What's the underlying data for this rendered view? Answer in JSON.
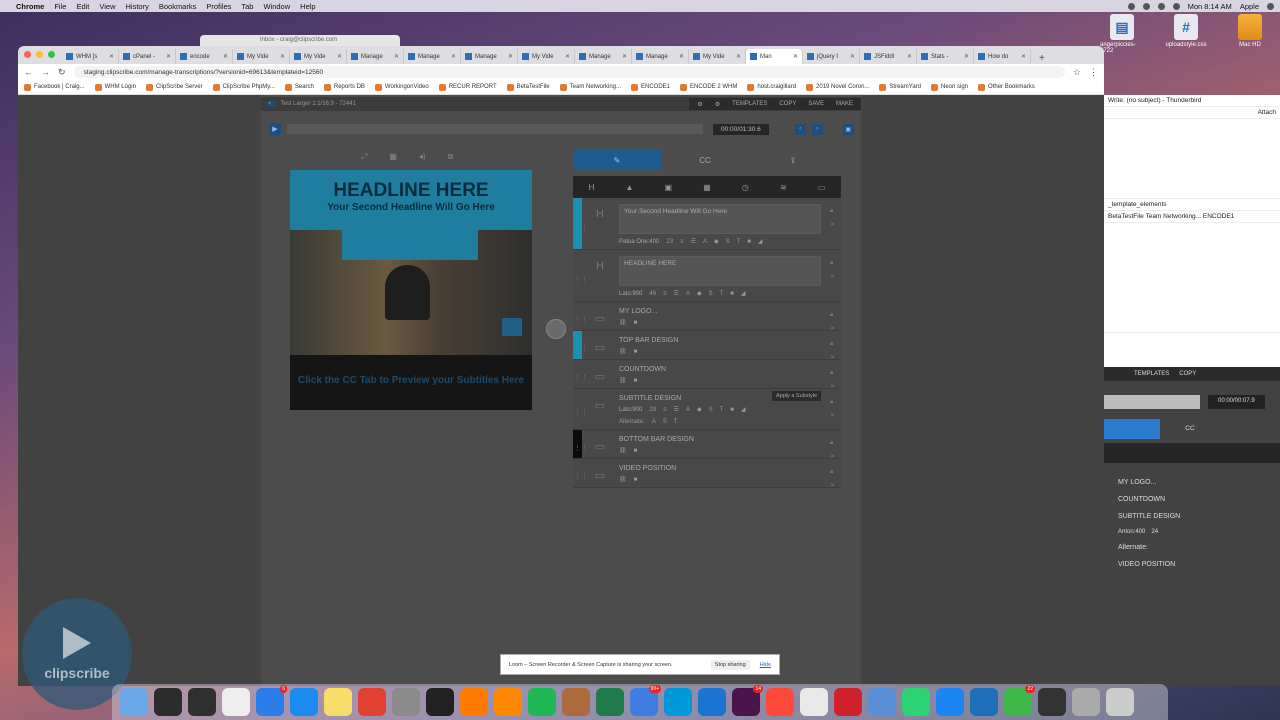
{
  "menubar": {
    "app": "Chrome",
    "items": [
      "File",
      "Edit",
      "View",
      "History",
      "Bookmarks",
      "Profiles",
      "Tab",
      "Window",
      "Help"
    ],
    "clock": "Mon 8:14 AM",
    "user": "Apple"
  },
  "desktop": {
    "icons": [
      {
        "label": "angerpiccies-4722",
        "icon": "file-icon"
      },
      {
        "label": "uploadstyle.css",
        "icon": "css-file-icon"
      },
      {
        "label": "Mac HD",
        "icon": "hard-drive-icon"
      }
    ],
    "bg_window_text": "Inbox - craig@clipscribe.com"
  },
  "browser": {
    "tabs": [
      "WHM [s",
      "cPanel -",
      "encode",
      "My Vide",
      "My Vide",
      "Manage",
      "Manage",
      "Manage",
      "My Vide",
      "Manage",
      "Manage",
      "My Vide",
      "Man",
      "jQuery t",
      "JSFiddl",
      "Stats -",
      "How do"
    ],
    "active_tab": 12,
    "url": "staging.clipscribe.com/manage-transcriptions/?versionid=69613&templateid=12560",
    "bookmarks": [
      "Facebook | Craig...",
      "WHM Login",
      "ClipScribe Server",
      "ClipScribe PhpMy...",
      "Search",
      "Reports DB",
      "WorkingonVideo",
      "RECUR REPORT",
      "BetaTestFile",
      "Team Networking...",
      "ENCODE1",
      "ENCODE 2 WHM",
      "host.craigillard",
      "2019 Novel Coron...",
      "StreamYard",
      "Neon sign",
      "Other Bookmarks"
    ]
  },
  "app": {
    "project_title": "Test Larger 1:1/16:9 - 72441",
    "header_actions": [
      "TEMPLATES",
      "COPY",
      "SAVE",
      "MAKE"
    ],
    "time": "00:00/01:30.6",
    "preview": {
      "headline": "HEADLINE HERE",
      "subheadline": "Your Second Headline Will Go Here",
      "cc_hint": "Click the CC Tab to Preview your Subtitles Here"
    },
    "panel_tabs": [
      "CC"
    ],
    "elements": [
      {
        "title": "",
        "field": "Your Second Headline Will Go Here",
        "font": "Patua One:400",
        "size": "23",
        "stripe": "#1a8fb8"
      },
      {
        "title": "",
        "field": "HEADLINE HERE",
        "font": "Lato:900",
        "size": "46",
        "stripe": ""
      },
      {
        "title": "MY LOGO...",
        "stripe": ""
      },
      {
        "title": "TOP BAR DESIGN",
        "stripe": "#1a8fb8"
      },
      {
        "title": "COUNTDOWN",
        "stripe": ""
      },
      {
        "title": "SUBTITLE DESIGN",
        "font": "Lato:900",
        "size": "29",
        "alternate": "Alternate:",
        "tooltip": "Apply a Substyle",
        "stripe": ""
      },
      {
        "title": "BOTTOM BAR DESIGN",
        "stripe": "#0b0b0b"
      },
      {
        "title": "VIDEO POSITION",
        "stripe": ""
      }
    ]
  },
  "right_window": {
    "lines": [
      "Write: (no subject) - Thunderbird",
      "Attach",
      "_template_elements",
      "BetaTestFile  Team Networking...  ENCODE1",
      "ENCODE 2 WHM  host.craigillard  2019 Nov"
    ],
    "actions": [
      "TEMPLATES",
      "COPY"
    ],
    "time": "00:00/00:07.9",
    "cc": "CC",
    "items": [
      "MY LOGO...",
      "COUNTDOWN",
      "SUBTITLE DESIGN",
      "Alternate:",
      "VIDEO POSITION"
    ],
    "font": "Anton:400",
    "size": "24"
  },
  "loom": {
    "text": "Loom – Screen Recorder & Screen Capture is sharing your screen.",
    "stop": "Stop sharing",
    "hide": "Hide"
  },
  "watermark": "clipscribe",
  "dock_badges": {
    "appstore": "6",
    "mail": "99+",
    "slack": "14",
    "facetime": "22"
  }
}
